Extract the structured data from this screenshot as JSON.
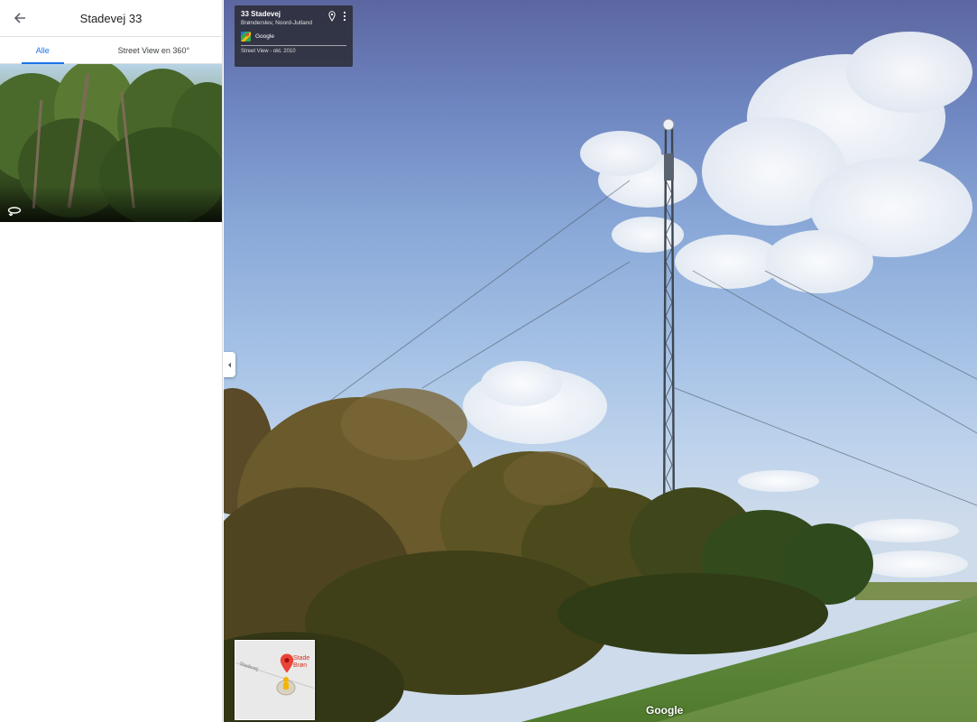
{
  "sidebar": {
    "title": "Stadevej 33",
    "back_icon": "arrow-left-icon",
    "tabs": [
      {
        "label": "Alle",
        "active": true
      },
      {
        "label": "Street View en 360°",
        "active": false
      }
    ],
    "photo_icon": "rotate-360-icon"
  },
  "streetview": {
    "info_card": {
      "title": "33 Stadevej",
      "subtitle": "Brønderslev, Noord-Jutland",
      "brand": "Google",
      "date": "Street View - okt. 2010",
      "pin_icon": "location-pin-icon",
      "more_icon": "more-vertical-icon"
    },
    "collapse_icon": "chevron-left-icon",
    "minimap": {
      "road_label": "Stadevej",
      "place_label_line1": "Stade",
      "place_label_line2": "Brøn"
    },
    "watermark": "Google"
  },
  "colors": {
    "accent": "#1a73e8",
    "pin_red": "#ea4335",
    "sky_top": "#5c66a0",
    "grass": "#5a8a3a"
  }
}
